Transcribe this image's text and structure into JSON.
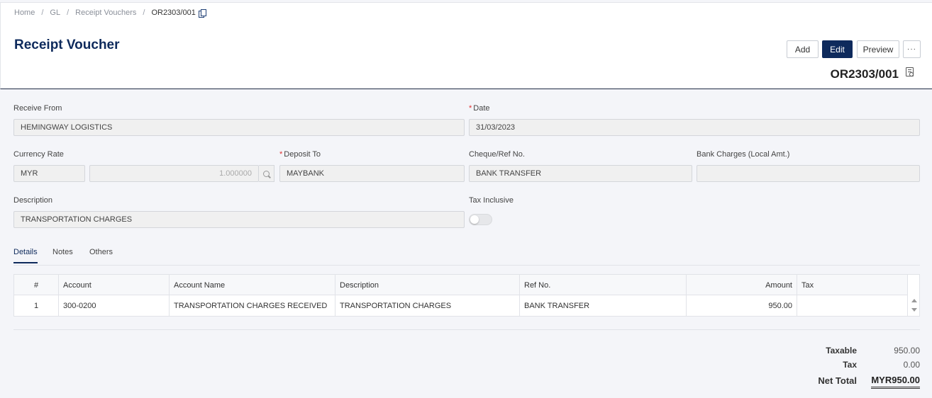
{
  "breadcrumb": {
    "home": "Home",
    "gl": "GL",
    "receipt_vouchers": "Receipt Vouchers",
    "current": "OR2303/001"
  },
  "page": {
    "title": "Receipt Voucher",
    "document_number": "OR2303/001"
  },
  "actions": {
    "add": "Add",
    "edit": "Edit",
    "preview": "Preview",
    "more": "···"
  },
  "form": {
    "receive_from": {
      "label": "Receive From",
      "value": "HEMINGWAY LOGISTICS"
    },
    "date": {
      "label": "Date",
      "value": "31/03/2023",
      "required_mark": "*"
    },
    "currency_rate": {
      "label": "Currency Rate",
      "currency": "MYR",
      "rate": "1.000000"
    },
    "deposit_to": {
      "label": "Deposit To",
      "value": "MAYBANK",
      "required_mark": "*"
    },
    "cheque_ref": {
      "label": "Cheque/Ref No.",
      "value": "BANK TRANSFER"
    },
    "bank_charges": {
      "label": "Bank Charges (Local Amt.)",
      "value": ""
    },
    "description": {
      "label": "Description",
      "value": "TRANSPORTATION CHARGES"
    },
    "tax_inclusive": {
      "label": "Tax Inclusive",
      "enabled": false
    }
  },
  "tabs": [
    "Details",
    "Notes",
    "Others"
  ],
  "table": {
    "columns": [
      "#",
      "Account",
      "Account Name",
      "Description",
      "Ref No.",
      "Amount",
      "Tax"
    ],
    "rows": [
      [
        "1",
        "300-0200",
        "TRANSPORTATION CHARGES RECEIVED",
        "TRANSPORTATION CHARGES",
        "BANK TRANSFER",
        "950.00",
        ""
      ]
    ]
  },
  "totals": {
    "taxable_label": "Taxable",
    "taxable_value": "950.00",
    "tax_label": "Tax",
    "tax_value": "0.00",
    "net_label": "Net Total",
    "net_value": "MYR950.00"
  },
  "colors": {
    "primary": "#0e2a5c",
    "required": "#e03030"
  }
}
